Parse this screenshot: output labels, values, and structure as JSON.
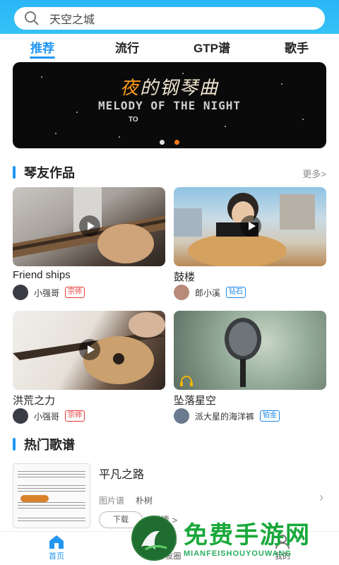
{
  "search": {
    "text": "天空之城",
    "icon": "search-icon"
  },
  "tabs": [
    {
      "label": "推荐",
      "active": true
    },
    {
      "label": "流行",
      "active": false
    },
    {
      "label": "GTP谱",
      "active": false
    },
    {
      "label": "歌手",
      "active": false
    }
  ],
  "banner": {
    "title_first": "夜",
    "title_rest": "的钢琴曲",
    "subtitle": "MELODY OF THE NIGHT",
    "small": "TO",
    "dots": 2,
    "active_dot": 2
  },
  "works_section": {
    "title": "琴友作品",
    "more": "更多>"
  },
  "works": [
    {
      "title": "Friend ships",
      "author": "小强哥",
      "badge": "宗师",
      "badge_color": "#e53935"
    },
    {
      "title": "鼓楼",
      "author": "郎小溪",
      "badge": "钻石",
      "badge_color": "#1e88e5"
    },
    {
      "title": "洪荒之力",
      "author": "小强哥",
      "badge": "宗师",
      "badge_color": "#e53935"
    },
    {
      "title": "坠落星空",
      "author": "派大星的海洋裤",
      "badge": "铂金",
      "badge_color": "#1e88e5"
    }
  ],
  "hot_section": {
    "title": "热门歌谱"
  },
  "hot": {
    "song": "平凡之路",
    "type": "图片谱",
    "artist": "朴树",
    "download": "下载",
    "detail": "详情 >"
  },
  "nav": [
    {
      "label": "首页",
      "icon": "home-icon",
      "active": true
    },
    {
      "label": "琴友圈",
      "icon": "circle-icon",
      "active": false
    },
    {
      "label": "我的",
      "icon": "user-icon",
      "active": false
    }
  ],
  "watermark": {
    "text": "免费手游网",
    "sub": "MIANFEISHOUYOUWANG"
  },
  "colors": {
    "accent": "#2196f3",
    "header": "#29b6f6"
  }
}
